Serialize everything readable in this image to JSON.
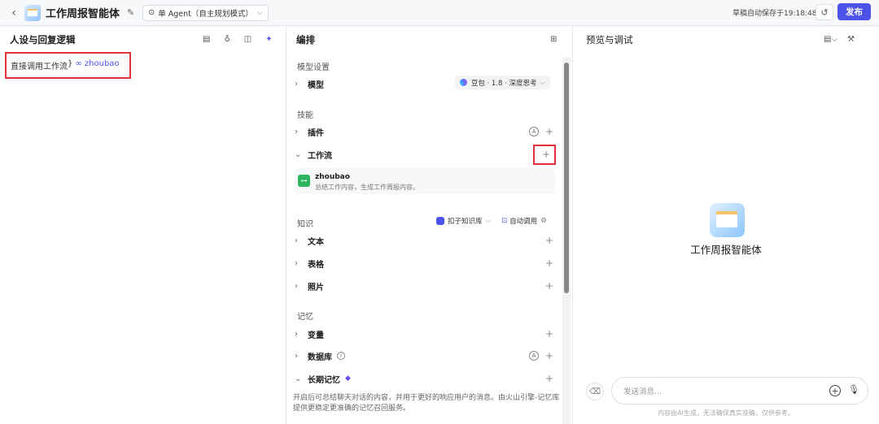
{
  "header": {
    "title": "工作周报智能体",
    "mode": "单 Agent（自主规划模式）",
    "autosave": "草稿自动保存于19:18:48",
    "publish": "发布"
  },
  "left": {
    "title": "人设与回复逻辑",
    "prompt_text": "直接调用工作流",
    "prompt_chip": "zhoubao"
  },
  "middle": {
    "title": "编排",
    "model_section": "模型设置",
    "model_row": "模型",
    "model_value": "豆包 · 1.8 · 深度思考",
    "skills_section": "技能",
    "plugins": "插件",
    "workflow": "工作流",
    "workflow_item": {
      "name": "zhoubao",
      "desc": "总结工作内容，生成工作周报内容。"
    },
    "knowledge_section": "知识",
    "kb_source": "扣子知识库",
    "kb_mode": "自动调用",
    "text": "文本",
    "table": "表格",
    "photo": "照片",
    "memory_section": "记忆",
    "variables": "变量",
    "database": "数据库",
    "long_memory": "长期记忆",
    "memory_desc": "开启后可总结聊天对话的内容，并用于更好的响应用户的消息。由火山引擎-记忆库提供更稳定更准确的记忆召回服务。"
  },
  "right": {
    "title": "预览与调试",
    "bot_name": "工作周报智能体",
    "input_placeholder": "发送消息...",
    "disclaimer": "内容由AI生成，无法确保真实准确，仅供参考。"
  },
  "colors": {
    "accent": "#4d53e8",
    "highlight": "#e0323b",
    "workflow_icon": "#2fb55f"
  }
}
